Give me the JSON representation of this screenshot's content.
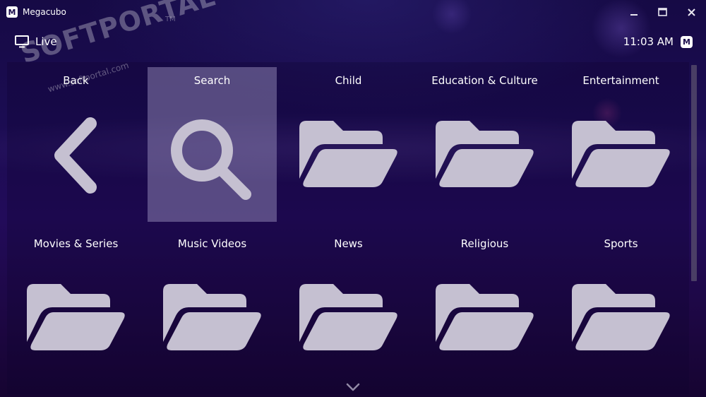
{
  "window": {
    "title": "Megacubo",
    "logo_glyph": "M",
    "controls": {
      "minimize": "—",
      "maximize": "☐",
      "close": "✕"
    }
  },
  "header": {
    "section_label": "Live",
    "section_icon": "monitor-icon",
    "clock": "11:03 AM",
    "brand_glyph": "M"
  },
  "grid": {
    "tiles": [
      {
        "label": "Back",
        "icon": "chevron-left-icon"
      },
      {
        "label": "Search",
        "icon": "search-icon",
        "selected": true
      },
      {
        "label": "Child",
        "icon": "folder-icon"
      },
      {
        "label": "Education & Culture",
        "icon": "folder-icon"
      },
      {
        "label": "Entertainment",
        "icon": "folder-icon"
      },
      {
        "label": "Movies & Series",
        "icon": "folder-icon"
      },
      {
        "label": "Music Videos",
        "icon": "folder-icon"
      },
      {
        "label": "News",
        "icon": "folder-icon"
      },
      {
        "label": "Religious",
        "icon": "folder-icon"
      },
      {
        "label": "Sports",
        "icon": "folder-icon"
      }
    ]
  },
  "watermark": {
    "brand": "SOFTPORTAL",
    "url": "www.softportal.com",
    "mark": "TM"
  },
  "colors": {
    "icon_fill": "#c5c0d1",
    "selected_tile": "#8a82ad",
    "background": "#1b0c52"
  }
}
